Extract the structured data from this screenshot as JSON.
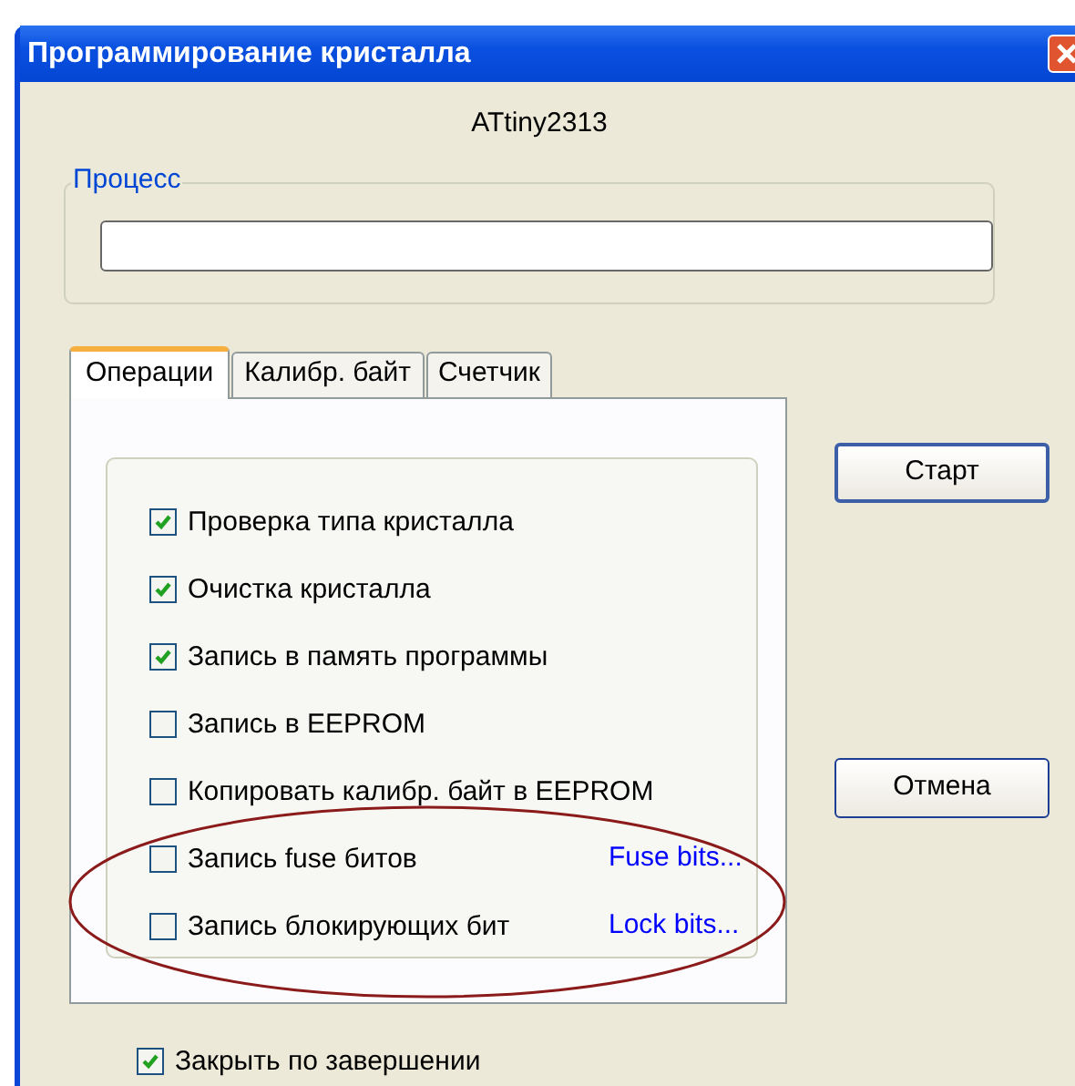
{
  "window": {
    "title": "Программирование кристалла"
  },
  "device": "ATtiny2313",
  "process": {
    "label": "Процесс"
  },
  "tabs": [
    {
      "label": "Операции",
      "selected": true
    },
    {
      "label": "Калибр. байт",
      "selected": false
    },
    {
      "label": "Счетчик",
      "selected": false
    }
  ],
  "operations": [
    {
      "label": "Проверка типа кристалла",
      "checked": true
    },
    {
      "label": "Очистка кристалла",
      "checked": true
    },
    {
      "label": "Запись в память программы",
      "checked": true
    },
    {
      "label": "Запись в EEPROM",
      "checked": false
    },
    {
      "label": "Копировать калибр. байт в EEPROM",
      "checked": false
    },
    {
      "label": "Запись fuse битов",
      "checked": false,
      "link": "Fuse bits...",
      "highlighted": true
    },
    {
      "label": "Запись блокирующих бит",
      "checked": false,
      "link": "Lock bits...",
      "highlighted": true
    }
  ],
  "buttons": [
    "Старт",
    "Отмена"
  ],
  "close_on_finish": {
    "label": "Закрыть по завершении",
    "checked": true
  }
}
